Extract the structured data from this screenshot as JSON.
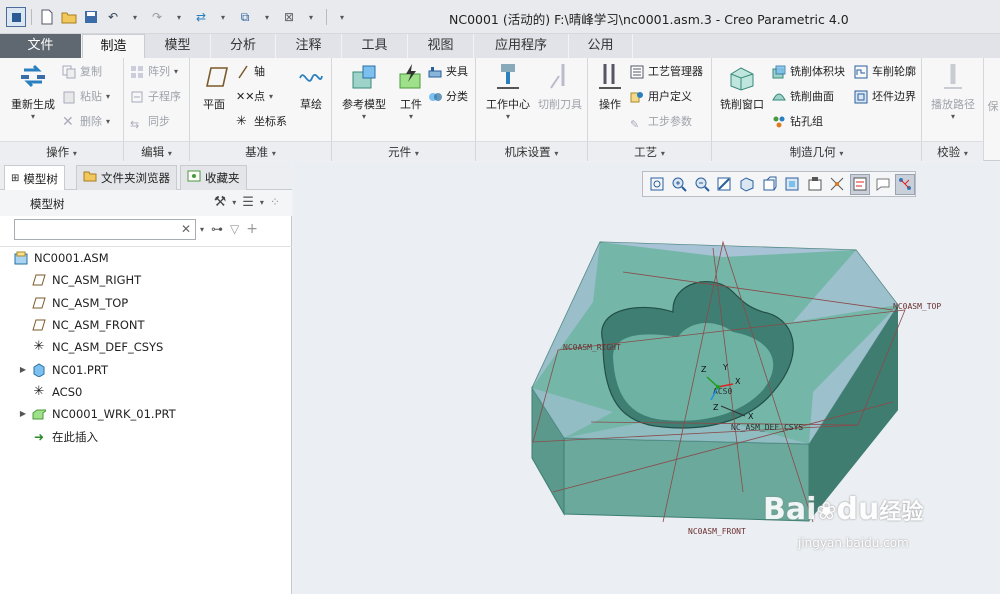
{
  "window": {
    "title": "NC0001 (活动的) F:\\晴峰学习\\nc0001.asm.3 - Creo Parametric 4.0"
  },
  "tabs": [
    {
      "label": "文件"
    },
    {
      "label": "制造"
    },
    {
      "label": "模型"
    },
    {
      "label": "分析"
    },
    {
      "label": "注释"
    },
    {
      "label": "工具"
    },
    {
      "label": "视图"
    },
    {
      "label": "应用程序"
    },
    {
      "label": "公用"
    }
  ],
  "ribbon": {
    "operations": {
      "label": "操作",
      "regenerate": "重新生成",
      "copy": "复制",
      "paste": "粘贴",
      "delete": "删除"
    },
    "edit": {
      "label": "编辑",
      "array": "阵列",
      "subprogram": "子程序",
      "sync": "同步"
    },
    "datum": {
      "label": "基准",
      "plane": "平面",
      "axis": "轴",
      "point": "点",
      "csys": "坐标系",
      "sketch": "草绘"
    },
    "component": {
      "label": "元件",
      "ref_model": "参考模型",
      "workpiece": "工件",
      "fixture": "夹具",
      "classify": "分类"
    },
    "machine": {
      "label": "机床设置",
      "workcenter": "工作中心",
      "cutting_tool": "切削刀具"
    },
    "process": {
      "label": "工艺",
      "operation": "操作",
      "process_manager": "工艺管理器",
      "user_defined": "用户定义",
      "step_params": "工步参数"
    },
    "mfg_geom": {
      "label": "制造几何",
      "mill_window": "铣削窗口",
      "mill_volume": "铣削体积块",
      "mill_surface": "铣削曲面",
      "drill_group": "钻孔组",
      "turn_profile": "车削轮廓",
      "stock_boundary": "坯件边界"
    },
    "verify": {
      "label": "校验",
      "play_path": "播放路径"
    },
    "cut_off": "保"
  },
  "left_panel": {
    "tabs": [
      {
        "label": "模型树"
      },
      {
        "label": "文件夹浏览器"
      },
      {
        "label": "收藏夹"
      }
    ],
    "tree_title": "模型树",
    "search": {
      "value": ""
    },
    "tree": [
      {
        "label": "NC0001.ASM",
        "icon": "assembly-icon",
        "expandable": false
      },
      {
        "label": "NC_ASM_RIGHT",
        "icon": "plane-icon",
        "expandable": false
      },
      {
        "label": "NC_ASM_TOP",
        "icon": "plane-icon",
        "expandable": false
      },
      {
        "label": "NC_ASM_FRONT",
        "icon": "plane-icon",
        "expandable": false
      },
      {
        "label": "NC_ASM_DEF_CSYS",
        "icon": "csys-icon",
        "expandable": false
      },
      {
        "label": "NC01.PRT",
        "icon": "part-icon",
        "expandable": true
      },
      {
        "label": "ACS0",
        "icon": "csys-icon",
        "expandable": false
      },
      {
        "label": "NC0001_WRK_01.PRT",
        "icon": "workpiece-icon",
        "expandable": true
      },
      {
        "label": "在此插入",
        "icon": "insert-arrow-icon",
        "expandable": false
      }
    ]
  },
  "graphics": {
    "labels": {
      "top": "NC0ASM_TOP",
      "right": "NC0ASM_RIGHT",
      "front": "NC0ASM_FRONT",
      "csys": "NC_ASM_DEF_CSYS",
      "acs": "ACS0"
    }
  },
  "watermark": {
    "brand": "Bai",
    "brand2": "du",
    "suffix": "经验",
    "url": "jingyan.baidu.com"
  },
  "colors": {
    "workpiece": "#6fb3a3",
    "accent": "#2c5a92"
  }
}
